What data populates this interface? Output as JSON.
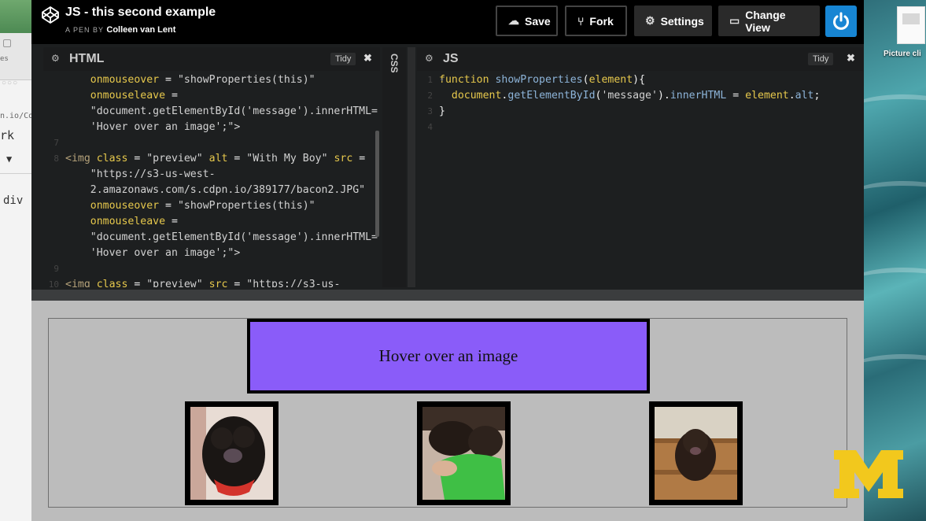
{
  "app": {
    "title": "JS - this second example",
    "byline_prefix": "A PEN BY",
    "author": "Colleen van Lent"
  },
  "toolbar": {
    "save": "Save",
    "fork": "Fork",
    "settings": "Settings",
    "change_view": "Change View"
  },
  "html_editor": {
    "title": "HTML",
    "tidy": "Tidy",
    "lines": [
      {
        "n": "",
        "tokens": [
          [
            "",
            "    "
          ],
          [
            "attr",
            "onmouseover"
          ],
          [
            "punc",
            " = "
          ],
          [
            "str",
            "\"showProperties(this)\""
          ]
        ]
      },
      {
        "n": "",
        "tokens": [
          [
            "",
            "    "
          ],
          [
            "attr",
            "onmouseleave"
          ],
          [
            "punc",
            " ="
          ]
        ]
      },
      {
        "n": "",
        "tokens": [
          [
            "",
            "    "
          ],
          [
            "str",
            "\"document.getElementById('message').innerHTML="
          ]
        ]
      },
      {
        "n": "",
        "tokens": [
          [
            "",
            "    "
          ],
          [
            "str",
            "'Hover over an image';\">"
          ]
        ]
      },
      {
        "n": "7",
        "tokens": []
      },
      {
        "n": "8",
        "tokens": [
          [
            "tag",
            "<img "
          ],
          [
            "attr",
            "class"
          ],
          [
            "punc",
            " = "
          ],
          [
            "str",
            "\"preview\" "
          ],
          [
            "attr",
            "alt"
          ],
          [
            "punc",
            " = "
          ],
          [
            "str",
            "\"With My Boy\" "
          ],
          [
            "attr",
            "src"
          ],
          [
            "punc",
            " ="
          ]
        ]
      },
      {
        "n": "",
        "tokens": [
          [
            "",
            "    "
          ],
          [
            "str",
            "\"https://s3-us-west-"
          ]
        ]
      },
      {
        "n": "",
        "tokens": [
          [
            "",
            "    "
          ],
          [
            "str",
            "2.amazonaws.com/s.cdpn.io/389177/bacon2.JPG\""
          ]
        ]
      },
      {
        "n": "",
        "tokens": [
          [
            "",
            "    "
          ],
          [
            "attr",
            "onmouseover"
          ],
          [
            "punc",
            " = "
          ],
          [
            "str",
            "\"showProperties(this)\""
          ]
        ]
      },
      {
        "n": "",
        "tokens": [
          [
            "",
            "    "
          ],
          [
            "attr",
            "onmouseleave"
          ],
          [
            "punc",
            " ="
          ]
        ]
      },
      {
        "n": "",
        "tokens": [
          [
            "",
            "    "
          ],
          [
            "str",
            "\"document.getElementById('message').innerHTML="
          ]
        ]
      },
      {
        "n": "",
        "tokens": [
          [
            "",
            "    "
          ],
          [
            "str",
            "'Hover over an image';\">"
          ]
        ]
      },
      {
        "n": "9",
        "tokens": []
      },
      {
        "n": "10",
        "tokens": [
          [
            "tag",
            "<img "
          ],
          [
            "attr",
            "class"
          ],
          [
            "punc",
            " = "
          ],
          [
            "str",
            "\"preview\" "
          ],
          [
            "attr",
            "src"
          ],
          [
            "punc",
            " = "
          ],
          [
            "str",
            "\"https://s3-us-"
          ]
        ]
      }
    ]
  },
  "css_tab": {
    "label": "CSS"
  },
  "js_editor": {
    "title": "JS",
    "tidy": "Tidy",
    "lines": [
      {
        "n": "1",
        "tokens": [
          [
            "kw",
            "function "
          ],
          [
            "fn",
            "showProperties"
          ],
          [
            "punc",
            "("
          ],
          [
            "kw",
            "element"
          ],
          [
            "punc",
            "){"
          ]
        ]
      },
      {
        "n": "2",
        "tokens": [
          [
            "",
            "  "
          ],
          [
            "kw",
            "document"
          ],
          [
            "punc",
            "."
          ],
          [
            "fn",
            "getElementById"
          ],
          [
            "punc",
            "("
          ],
          [
            "str",
            "'message'"
          ],
          [
            "punc",
            ")."
          ],
          [
            "fn",
            "innerHTML"
          ],
          [
            "punc",
            " = "
          ],
          [
            "kw",
            "element"
          ],
          [
            "punc",
            "."
          ],
          [
            "fn",
            "alt"
          ],
          [
            "punc",
            ";"
          ]
        ]
      },
      {
        "n": "3",
        "tokens": [
          [
            "punc",
            "}"
          ]
        ]
      },
      {
        "n": "4",
        "tokens": []
      }
    ]
  },
  "result": {
    "message": "Hover over an image"
  },
  "background": {
    "left_fragments": [
      "n.io/Co",
      "rk",
      "div"
    ],
    "desktop_label": "Picture cli"
  },
  "colors": {
    "message_bg": "#8a5cf9",
    "power_button": "#1785d3",
    "result_bg": "#bcbcbc",
    "michigan_maize": "#f2c81d"
  }
}
